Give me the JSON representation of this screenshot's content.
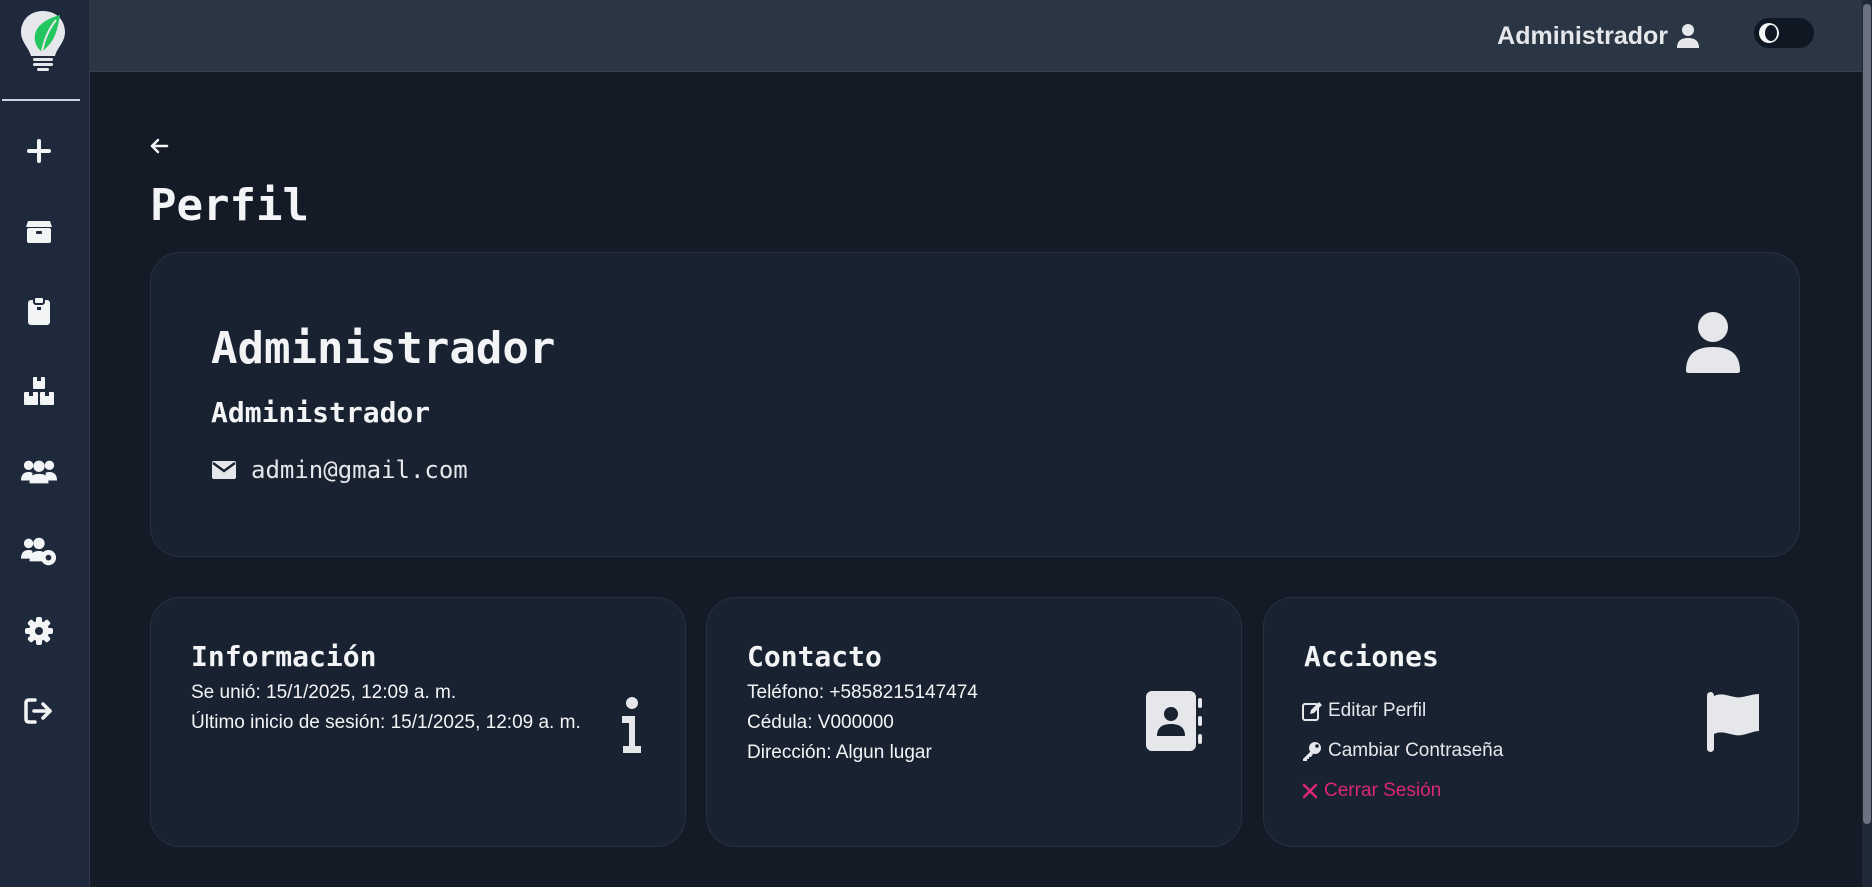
{
  "topbar": {
    "username": "Administrador",
    "user_icon": "user-icon",
    "theme_toggle_icon": "moon-icon"
  },
  "sidebar": {
    "logo_icon": "lightbulb-leaf-logo",
    "items": [
      {
        "name": "add",
        "icon": "plus-icon"
      },
      {
        "name": "inventory",
        "icon": "box-icon"
      },
      {
        "name": "orders",
        "icon": "clipboard-icon"
      },
      {
        "name": "products",
        "icon": "boxes-stacked-icon"
      },
      {
        "name": "clients",
        "icon": "users-icon"
      },
      {
        "name": "user-management",
        "icon": "users-gear-icon"
      },
      {
        "name": "settings",
        "icon": "gear-icon"
      },
      {
        "name": "logout",
        "icon": "sign-out-icon"
      }
    ]
  },
  "page": {
    "title": "Perfil",
    "back_icon": "arrow-left-icon"
  },
  "profile": {
    "name": "Administrador",
    "role": "Administrador",
    "email": "admin@gmail.com",
    "avatar_icon": "user-icon"
  },
  "info_card": {
    "title": "Información",
    "joined": "Se unió: 15/1/2025, 12:09 a. m.",
    "last_login": "Último inicio de sesión: 15/1/2025, 12:09 a. m.",
    "icon": "info-icon"
  },
  "contact_card": {
    "title": "Contacto",
    "phone": "Teléfono: +5858215147474",
    "id_number": "Cédula: V000000",
    "address": "Dirección: Algun lugar",
    "icon": "address-book-icon"
  },
  "actions_card": {
    "title": "Acciones",
    "edit_profile": "Editar Perfil",
    "change_password": "Cambiar Contraseña",
    "logout": "Cerrar Sesión",
    "icon": "flag-icon"
  },
  "colors": {
    "background": "#141b26",
    "sidebar": "#1e293b",
    "card": "#192231",
    "danger": "#db2777"
  }
}
